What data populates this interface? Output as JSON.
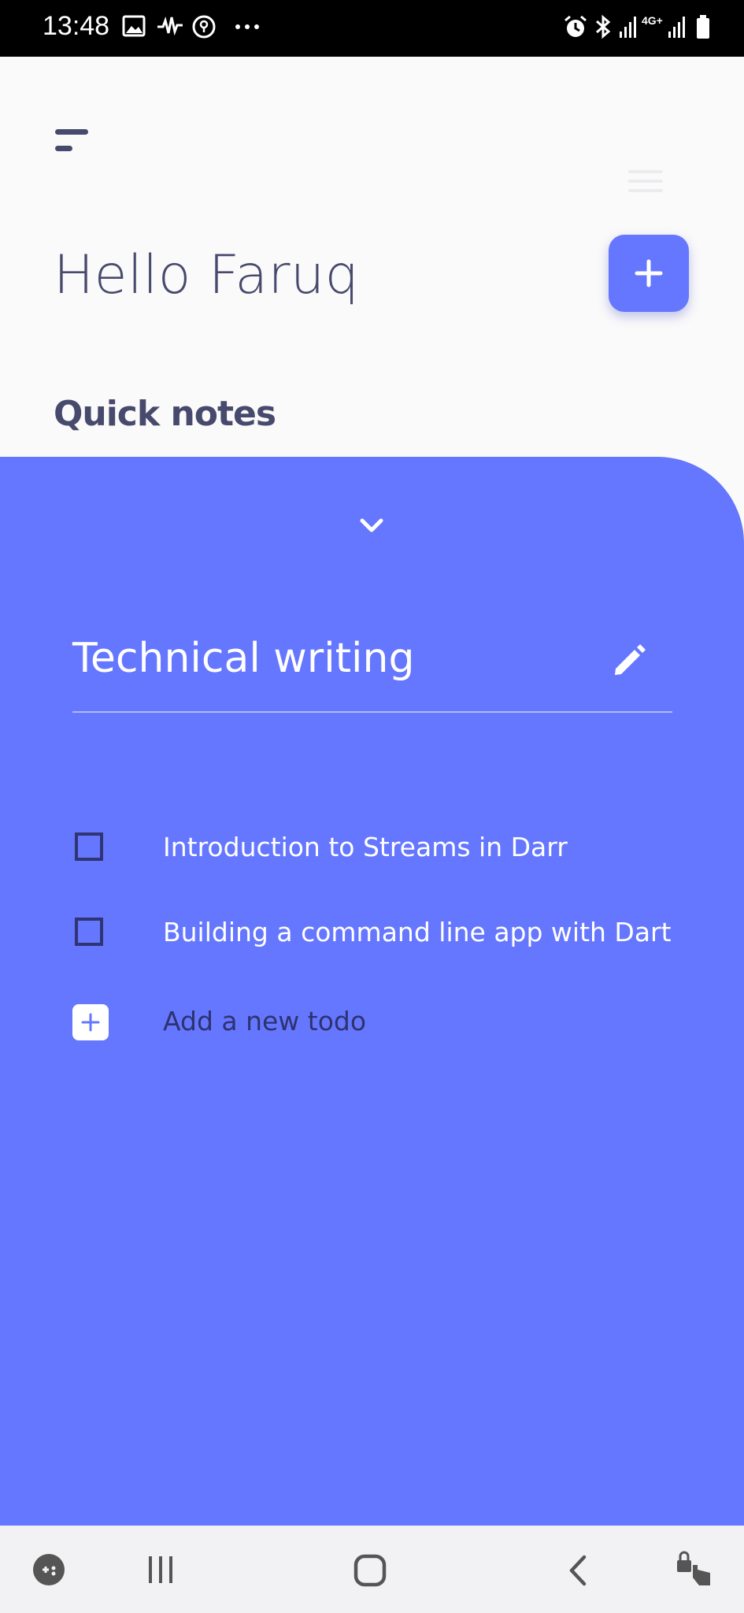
{
  "status_bar": {
    "time": "13:48",
    "left_icons": [
      "image-icon",
      "waveform-icon",
      "location-target-icon",
      "more-dots-icon"
    ],
    "right_icons": [
      "alarm-icon",
      "bluetooth-icon",
      "signal-icon",
      "4g-icon",
      "signal-icon",
      "battery-icon"
    ],
    "network_label": "4G+"
  },
  "header": {
    "greeting": "Hello Faruq",
    "section_title": "Quick notes"
  },
  "note": {
    "title": "Technical writing",
    "todos": [
      {
        "label": "Introduction to Streams in Darr",
        "checked": false
      },
      {
        "label": "Building a command line app with Dart",
        "checked": false
      }
    ],
    "add_todo_label": "Add a new todo"
  },
  "nav_bar": {
    "items": [
      "game-launcher-icon",
      "recent-apps-icon",
      "home-icon",
      "back-icon",
      "lock-touch-icon"
    ]
  },
  "colors": {
    "accent": "#6577fe",
    "text_dark": "#474a6d",
    "checkbox_border": "#2f3473",
    "background": "#fafafa"
  }
}
